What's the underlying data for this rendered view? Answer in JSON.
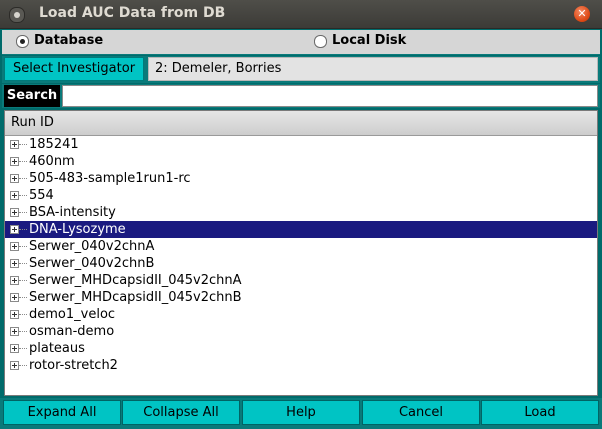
{
  "window": {
    "title": "Load AUC Data from DB"
  },
  "source": {
    "options": [
      {
        "label": "Database",
        "selected": true
      },
      {
        "label": "Local Disk",
        "selected": false
      }
    ]
  },
  "investigator": {
    "button_label": "Select Investigator",
    "value": "2: Demeler, Borries"
  },
  "search": {
    "label": "Search",
    "value": "",
    "placeholder": ""
  },
  "tree": {
    "column_header": "Run ID",
    "selected_index": 5,
    "items": [
      "185241",
      "460nm",
      "505-483-sample1run1-rc",
      "554",
      "BSA-intensity",
      "DNA-Lysozyme",
      "Serwer_040v2chnA",
      "Serwer_040v2chnB",
      "Serwer_MHDcapsidII_045v2chnA",
      "Serwer_MHDcapsidII_045v2chnB",
      "demo1_veloc",
      "osman-demo",
      "plateaus",
      "rotor-stretch2"
    ]
  },
  "buttons": {
    "expand_all": "Expand All",
    "collapse_all": "Collapse All",
    "help": "Help",
    "cancel": "Cancel",
    "load": "Load"
  },
  "colors": {
    "accent": "#00c4c4",
    "frame": "#0a7a7a",
    "selection": "#1a1a80",
    "titlebar": "#3c3b37",
    "close": "#dd4814"
  },
  "icons": {
    "window_menu": "window-menu-icon",
    "close": "close-icon",
    "expander": "tree-expand-icon"
  }
}
